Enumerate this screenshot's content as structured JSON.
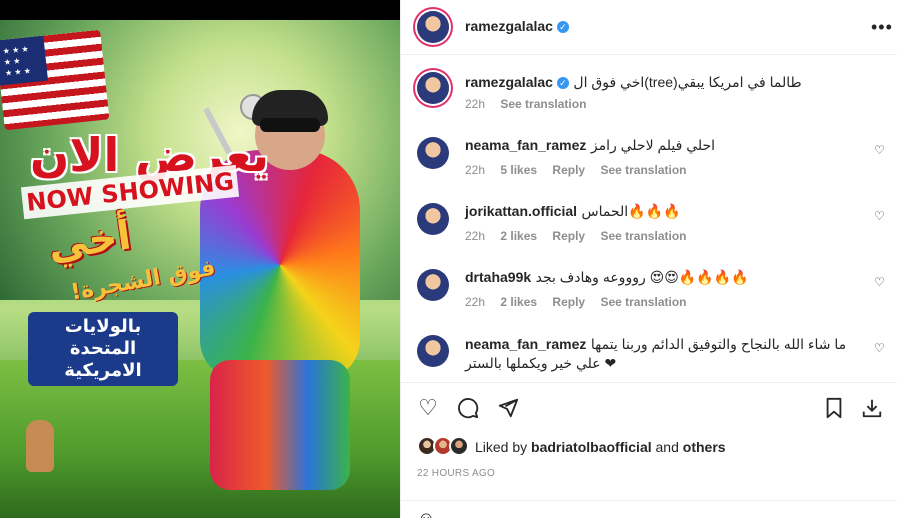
{
  "poster": {
    "arabic_now_showing": "يعرض الان",
    "english_now_showing": "NOW SHOWING",
    "arabic_title": "أخي",
    "arabic_subtitle": "فوق الشجرة!",
    "arabic_location": "بالولايات المتحدة الامريكية"
  },
  "header": {
    "username": "ramezgalalac",
    "verified_icon": "verified-badge-icon",
    "more_icon": "more-options-icon"
  },
  "caption": {
    "username": "ramezgalalac",
    "text": "اخي فوق ال(tree)طالما في امريكا يبقي",
    "time": "22h",
    "see_translation": "See translation"
  },
  "comments": [
    {
      "username": "neama_fan_ramez",
      "text": "احلي فيلم لاحلي رامز",
      "time": "22h",
      "likes": "5 likes",
      "reply": "Reply",
      "see_translation": "See translation"
    },
    {
      "username": "jorikattan.official",
      "text": "الحماس🔥🔥🔥",
      "time": "22h",
      "likes": "2 likes",
      "reply": "Reply",
      "see_translation": "See translation"
    },
    {
      "username": "drtaha99k",
      "text": "روووعه وهادف بجد 😍😍🔥🔥🔥🔥",
      "time": "22h",
      "likes": "2 likes",
      "reply": "Reply",
      "see_translation": "See translation"
    },
    {
      "username": "neama_fan_ramez",
      "text": "ما شاء الله بالنجاح والتوفيق الدائم وربنا يتمها علي خير ويكملها بالستر ❤"
    }
  ],
  "actions": {
    "like_icon": "heart-icon",
    "comment_icon": "comment-icon",
    "share_icon": "send-icon",
    "save_icon": "bookmark-icon",
    "download_icon": "download-icon"
  },
  "likes": {
    "prefix": "Liked by",
    "user": "badriatolbaofficial",
    "and": "and",
    "others": "others"
  },
  "timestamp": "22 HOURS AGO"
}
